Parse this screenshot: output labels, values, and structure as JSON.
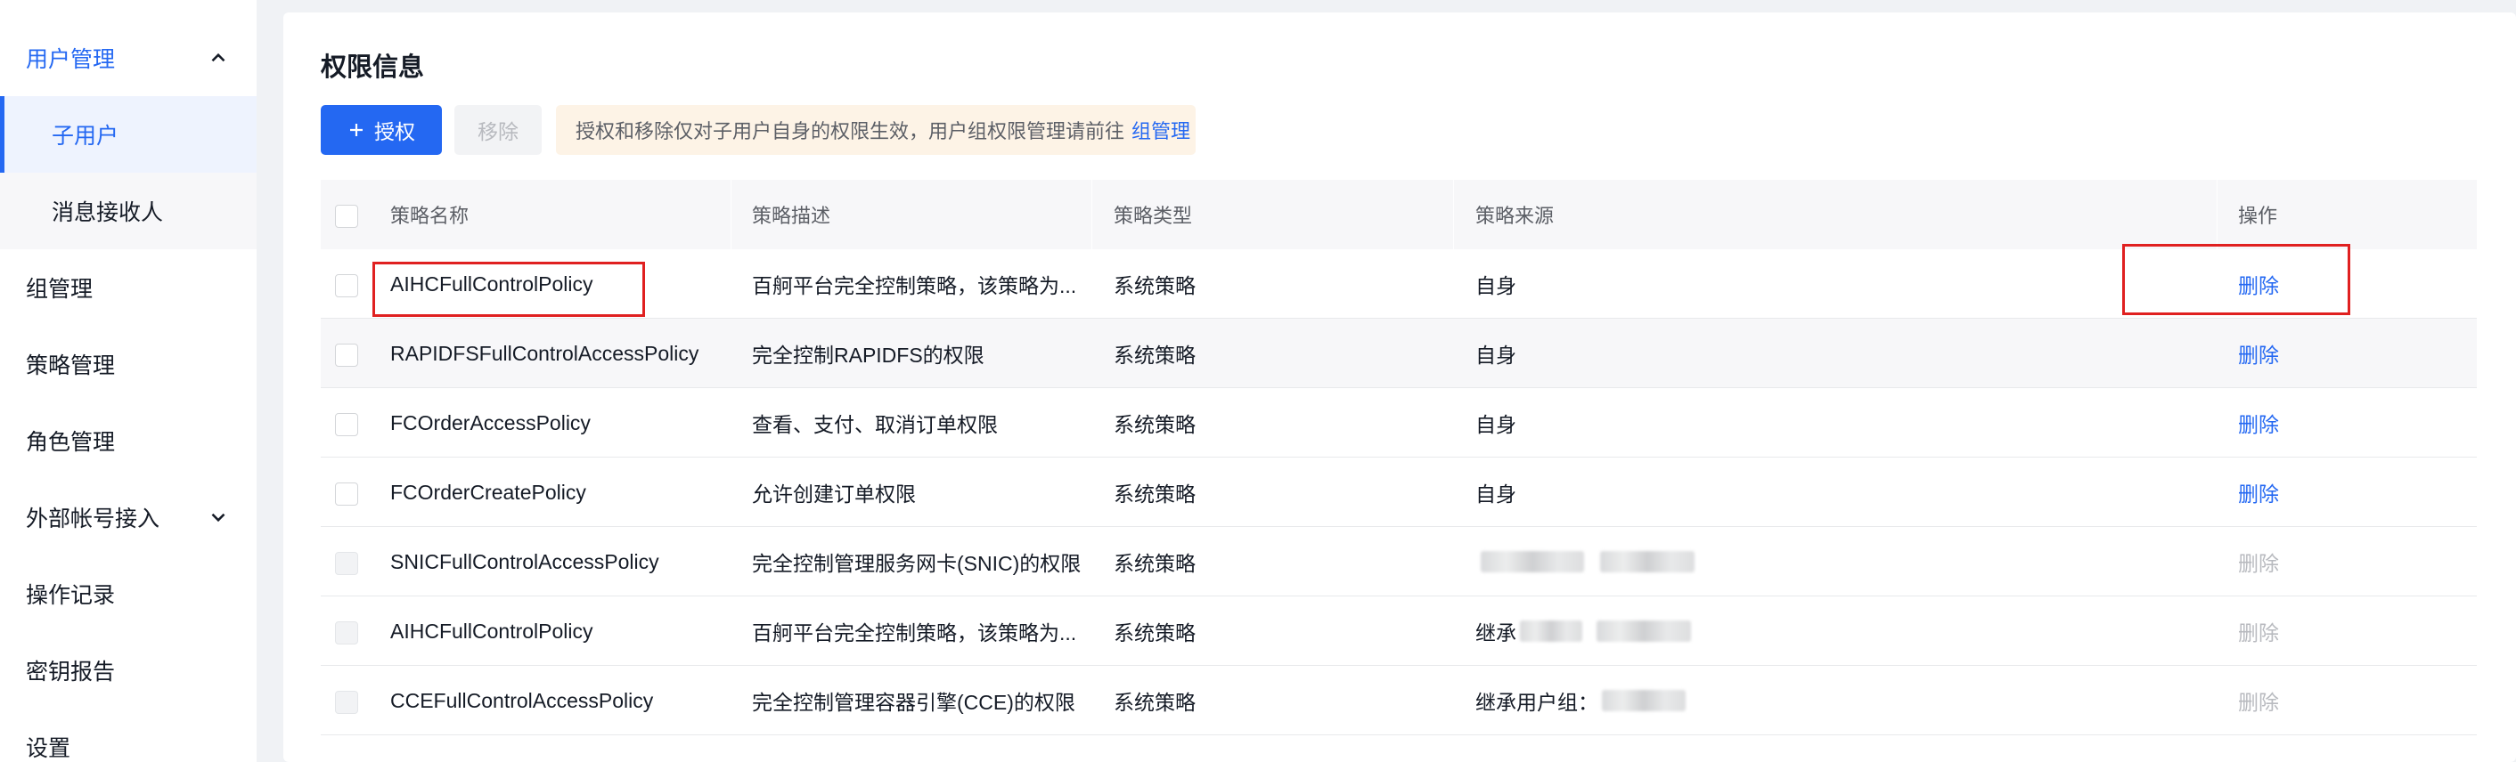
{
  "sidebar": {
    "items": [
      {
        "label": "用户管理",
        "type": "group-open"
      },
      {
        "label": "子用户",
        "type": "sub-active"
      },
      {
        "label": "消息接收人",
        "type": "sub"
      },
      {
        "label": "组管理",
        "type": "item"
      },
      {
        "label": "策略管理",
        "type": "item"
      },
      {
        "label": "角色管理",
        "type": "item"
      },
      {
        "label": "外部帐号接入",
        "type": "group-closed"
      },
      {
        "label": "操作记录",
        "type": "item"
      },
      {
        "label": "密钥报告",
        "type": "item"
      },
      {
        "label": "设置",
        "type": "item"
      }
    ]
  },
  "main": {
    "title": "权限信息",
    "grant_button": "授权",
    "remove_button": "移除",
    "tip_text": "授权和移除仅对子用户自身的权限生效，用户组权限管理请前往",
    "tip_link": "组管理"
  },
  "table": {
    "columns": [
      "策略名称",
      "策略描述",
      "策略类型",
      "策略来源",
      "操作"
    ],
    "rows": [
      {
        "name": "AIHCFullControlPolicy",
        "desc": "百舸平台完全控制策略，该策略为...",
        "type": "系统策略",
        "source": "自身",
        "action": "删除",
        "enabled": true
      },
      {
        "name": "RAPIDFSFullControlAccessPolicy",
        "desc": "完全控制RAPIDFS的权限",
        "type": "系统策略",
        "source": "自身",
        "action": "删除",
        "enabled": true
      },
      {
        "name": "FCOrderAccessPolicy",
        "desc": "查看、支付、取消订单权限",
        "type": "系统策略",
        "source": "自身",
        "action": "删除",
        "enabled": true
      },
      {
        "name": "FCOrderCreatePolicy",
        "desc": "允许创建订单权限",
        "type": "系统策略",
        "source": "自身",
        "action": "删除",
        "enabled": true
      },
      {
        "name": "SNICFullControlAccessPolicy",
        "desc": "完全控制管理服务网卡(SNIC)的权限",
        "type": "系统策略",
        "source": "",
        "action": "删除",
        "enabled": false
      },
      {
        "name": "AIHCFullControlPolicy",
        "desc": "百舸平台完全控制策略，该策略为...",
        "type": "系统策略",
        "source": "继承",
        "action": "删除",
        "enabled": false
      },
      {
        "name": "CCEFullControlAccessPolicy",
        "desc": "完全控制管理容器引擎(CCE)的权限",
        "type": "系统策略",
        "source": "继承用户组：",
        "action": "删除",
        "enabled": false
      }
    ]
  },
  "colors": {
    "primary": "#2468f2",
    "highlight_box": "#e02020",
    "disabled_text": "#b8babf",
    "tip_background": "#fdf3e6"
  }
}
